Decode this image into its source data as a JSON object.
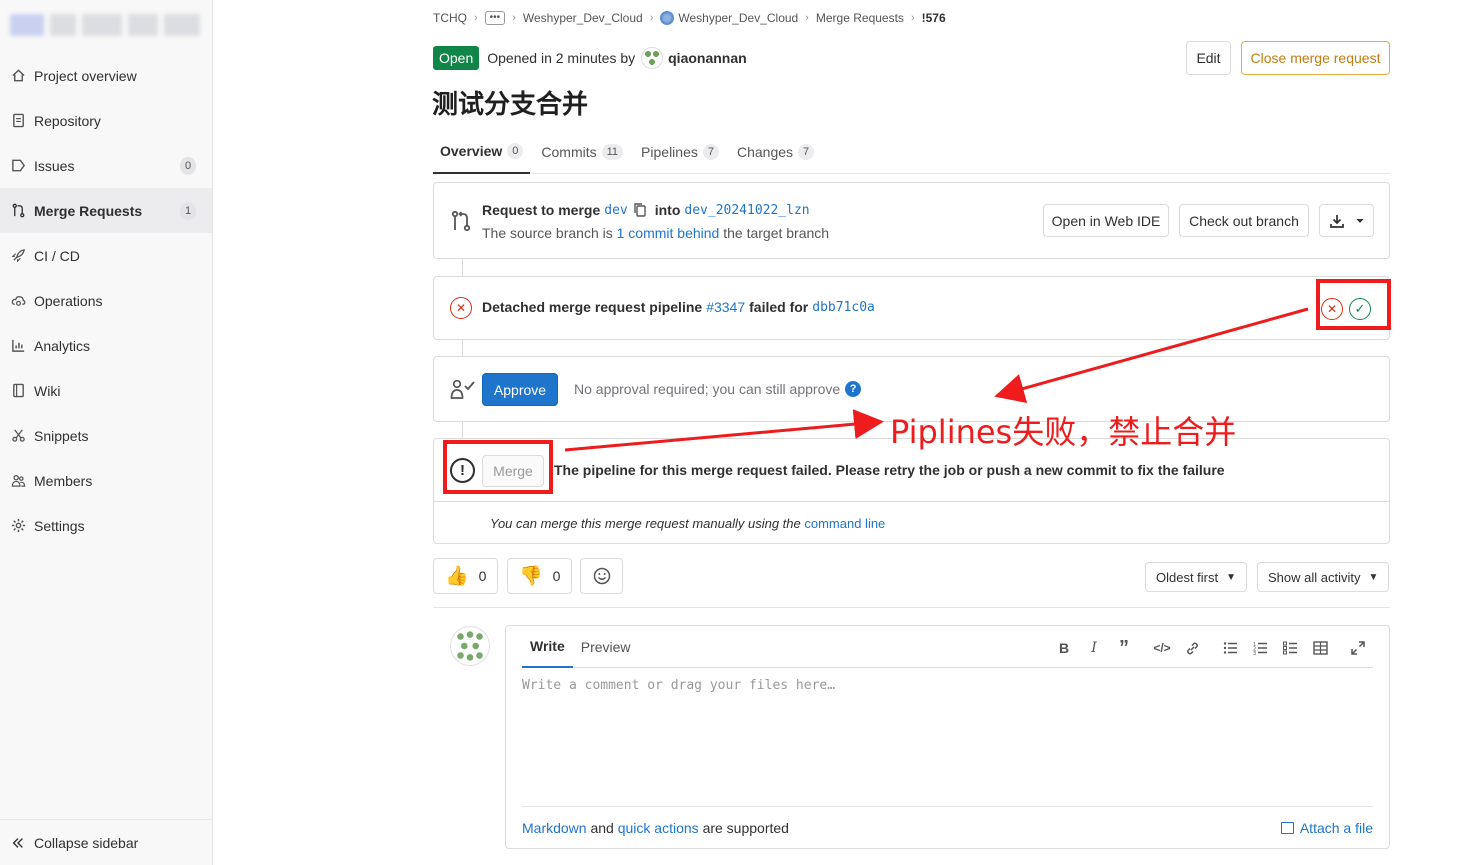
{
  "sidebar": {
    "items": [
      {
        "label": "Project overview",
        "icon": "home-icon",
        "badge": ""
      },
      {
        "label": "Repository",
        "icon": "doc-icon",
        "badge": ""
      },
      {
        "label": "Issues",
        "icon": "issues-icon",
        "badge": "0"
      },
      {
        "label": "Merge Requests",
        "icon": "git-merge-icon",
        "badge": "1",
        "active": true
      },
      {
        "label": "CI / CD",
        "icon": "rocket-icon",
        "badge": ""
      },
      {
        "label": "Operations",
        "icon": "cloud-gear-icon",
        "badge": ""
      },
      {
        "label": "Analytics",
        "icon": "chart-icon",
        "badge": ""
      },
      {
        "label": "Wiki",
        "icon": "book-icon",
        "badge": ""
      },
      {
        "label": "Snippets",
        "icon": "scissors-icon",
        "badge": ""
      },
      {
        "label": "Members",
        "icon": "users-icon",
        "badge": ""
      },
      {
        "label": "Settings",
        "icon": "gear-icon",
        "badge": ""
      }
    ],
    "collapse_label": "Collapse sidebar"
  },
  "breadcrumb": {
    "root": "TCHQ",
    "ellipsis": "•••",
    "group": "Weshyper_Dev_Cloud",
    "project": "Weshyper_Dev_Cloud",
    "section": "Merge Requests",
    "current": "!576"
  },
  "mr": {
    "status": "Open",
    "opened_text": "Opened in 2 minutes by",
    "author": "qiaonannan",
    "title": "测试分支合并",
    "edit_label": "Edit",
    "close_label": "Close merge request"
  },
  "tabs": [
    {
      "label": "Overview",
      "count": "0"
    },
    {
      "label": "Commits",
      "count": "11"
    },
    {
      "label": "Pipelines",
      "count": "7"
    },
    {
      "label": "Changes",
      "count": "7"
    }
  ],
  "request": {
    "prefix": "Request to merge",
    "source": "dev",
    "into": "into",
    "target": "dev_20241022_lzn",
    "behind_prefix": "The source branch is",
    "behind_link": "1 commit behind",
    "behind_suffix": "the target branch",
    "web_ide_label": "Open in Web IDE",
    "checkout_label": "Check out branch"
  },
  "pipeline": {
    "prefix": "Detached merge request pipeline",
    "id": "#3347",
    "middle": "failed for",
    "sha": "dbb71c0a"
  },
  "approval": {
    "button": "Approve",
    "text": "No approval required; you can still approve",
    "help": "?"
  },
  "merge": {
    "button": "Merge",
    "message": "The pipeline for this merge request failed. Please retry the job or push a new commit to fix the failure",
    "manual_prefix": "You can merge this merge request manually using the",
    "manual_link": "command line"
  },
  "reactions": {
    "thumbs_up": "0",
    "thumbs_down": "0"
  },
  "activity": {
    "sort_label": "Oldest first",
    "filter_label": "Show all activity"
  },
  "editor": {
    "write_tab": "Write",
    "preview_tab": "Preview",
    "placeholder": "Write a comment or drag your files here…",
    "markdown_link": "Markdown",
    "and": "and",
    "quick_actions_link": "quick actions",
    "supported": "are supported",
    "attach_label": "Attach a file"
  },
  "annotation": {
    "text": "Piplines失败，禁止合并",
    "color": "#ee1c1c"
  }
}
